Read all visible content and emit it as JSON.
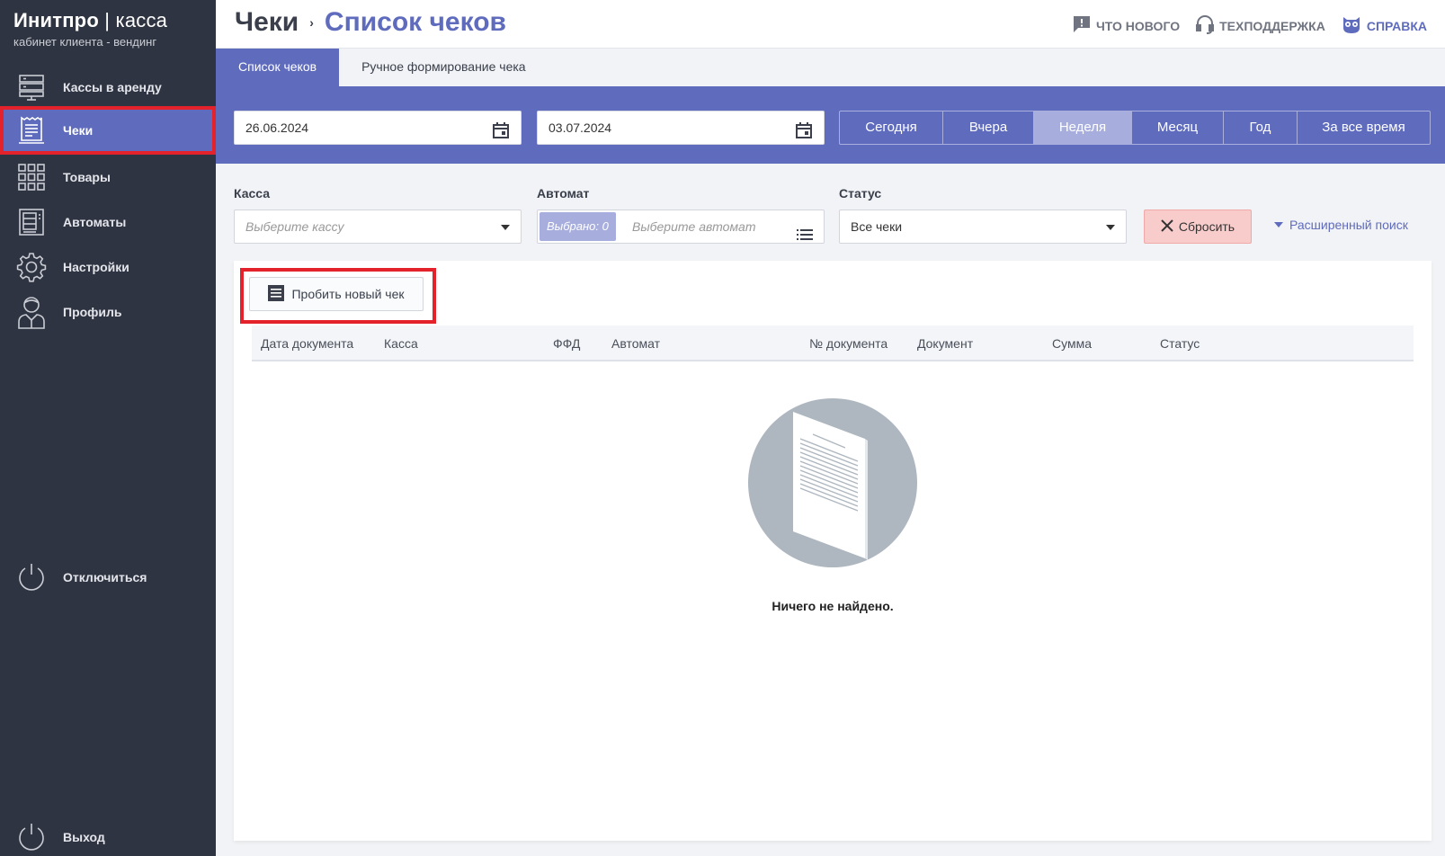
{
  "brand": {
    "name": "Инитпро",
    "divider": "|",
    "product": "касса",
    "subtitle": "кабинет клиента - вендинг"
  },
  "sidebar": {
    "items": [
      {
        "label": "Кассы в аренду",
        "icon": "server-icon"
      },
      {
        "label": "Чеки",
        "icon": "receipt-icon",
        "active": true
      },
      {
        "label": "Товары",
        "icon": "grid-icon"
      },
      {
        "label": "Автоматы",
        "icon": "vending-machine-icon"
      },
      {
        "label": "Настройки",
        "icon": "gear-icon"
      },
      {
        "label": "Профиль",
        "icon": "user-icon"
      }
    ],
    "disconnect_label": "Отключиться",
    "logout_label": "Выход"
  },
  "header": {
    "title": "Чеки",
    "separator": "›",
    "subtitle": "Список чеков",
    "links": [
      {
        "label": "ЧТО НОВОГО",
        "icon": "news-icon"
      },
      {
        "label": "ТЕХПОДДЕРЖКА",
        "icon": "headset-icon"
      },
      {
        "label": "СПРАВКА",
        "icon": "owl-icon"
      }
    ]
  },
  "tabs": [
    {
      "label": "Список чеков",
      "active": true
    },
    {
      "label": "Ручное формирование чека",
      "active": false
    }
  ],
  "dates": {
    "from": "26.06.2024",
    "to": "03.07.2024"
  },
  "periods": [
    {
      "label": "Сегодня"
    },
    {
      "label": "Вчера"
    },
    {
      "label": "Неделя",
      "active": true
    },
    {
      "label": "Месяц"
    },
    {
      "label": "Год"
    },
    {
      "label": "За все время"
    }
  ],
  "filters": {
    "kassa_label": "Касса",
    "kassa_placeholder": "Выберите кассу",
    "automat_label": "Автомат",
    "automat_chip": "Выбрано: 0",
    "automat_placeholder": "Выберите автомат",
    "status_label": "Статус",
    "status_value": "Все чеки",
    "reset_label": "Сбросить",
    "advanced_label": "Расширенный поиск"
  },
  "new_check_label": "Пробить новый чек",
  "table": {
    "columns": [
      "Дата документа",
      "Касса",
      "ФФД",
      "Автомат",
      "№ документа",
      "Документ",
      "Сумма",
      "Статус"
    ]
  },
  "empty_text": "Ничего не найдено.",
  "colors": {
    "accent": "#5f6bbd",
    "sidebar": "#2f3442",
    "highlight": "#e3222b",
    "reset": "#f8cccb"
  }
}
